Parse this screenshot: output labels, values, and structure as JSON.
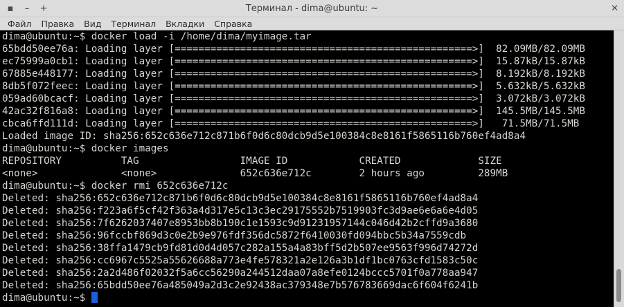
{
  "window": {
    "title": "Терминал - dima@ubuntu: ~",
    "buttons": {
      "minimize": "–",
      "maximize": "+",
      "close": "✕"
    },
    "menu_glyph": "▪"
  },
  "menu": [
    "Файл",
    "Правка",
    "Вид",
    "Терминал",
    "Вкладки",
    "Справка"
  ],
  "terminal": {
    "lines": [
      "dima@ubuntu:~$ docker load -i /home/dima/myimage.tar",
      "65bdd50ee76a: Loading layer [==================================================>]  82.09MB/82.09MB",
      "ec75999a0cb1: Loading layer [==================================================>]  15.87kB/15.87kB",
      "67885e448177: Loading layer [==================================================>]  8.192kB/8.192kB",
      "8db5f072feec: Loading layer [==================================================>]  5.632kB/5.632kB",
      "059ad60bcacf: Loading layer [==================================================>]  3.072kB/3.072kB",
      "42ac32f816a8: Loading layer [==================================================>]  145.5MB/145.5MB",
      "cbca6ffd111d: Loading layer [==================================================>]   71.5MB/71.5MB",
      "Loaded image ID: sha256:652c636e712c871b6f0d6c80dcb9d5e100384c8e8161f5865116b760ef4ad8a4",
      "dima@ubuntu:~$ docker images",
      "REPOSITORY          TAG                 IMAGE ID            CREATED             SIZE",
      "<none>              <none>              652c636e712c        2 hours ago         289MB",
      "dima@ubuntu:~$ docker rmi 652c636e712c",
      "Deleted: sha256:652c636e712c871b6f0d6c80dcb9d5e100384c8e8161f5865116b760ef4ad8a4",
      "Deleted: sha256:f223a6f5cf42f363a4d317e5c13c3ec29175552b7519903fc3d9ae6e6a6e4d05",
      "Deleted: sha256:7f6262037407e8953bb8b190c1e1593c9d91231957144c046d42b2cffd9a3680",
      "Deleted: sha256:96fccbf869d3c0e2b9e976fdf356dc5872f6410030fd094bbc5b34a7559cdb",
      "Deleted: sha256:38ffa1479cb9fd81d0d4d057c282a155a4a83bff5d2b507ee9563f996d74272d",
      "Deleted: sha256:cc6967c5525a55626688a773e4fe578321a2e126a3b1df1bc0763cfd1583c50c",
      "Deleted: sha256:2a2d486f02032f5a6cc56290a244512daa07a8efe0124bccc5701f0a778aa947",
      "Deleted: sha256:65bdd50ee76a485049a2d3c2e92438ac379348e7b576783669dac6f604f6241b"
    ],
    "prompt": "dima@ubuntu:~$ "
  }
}
